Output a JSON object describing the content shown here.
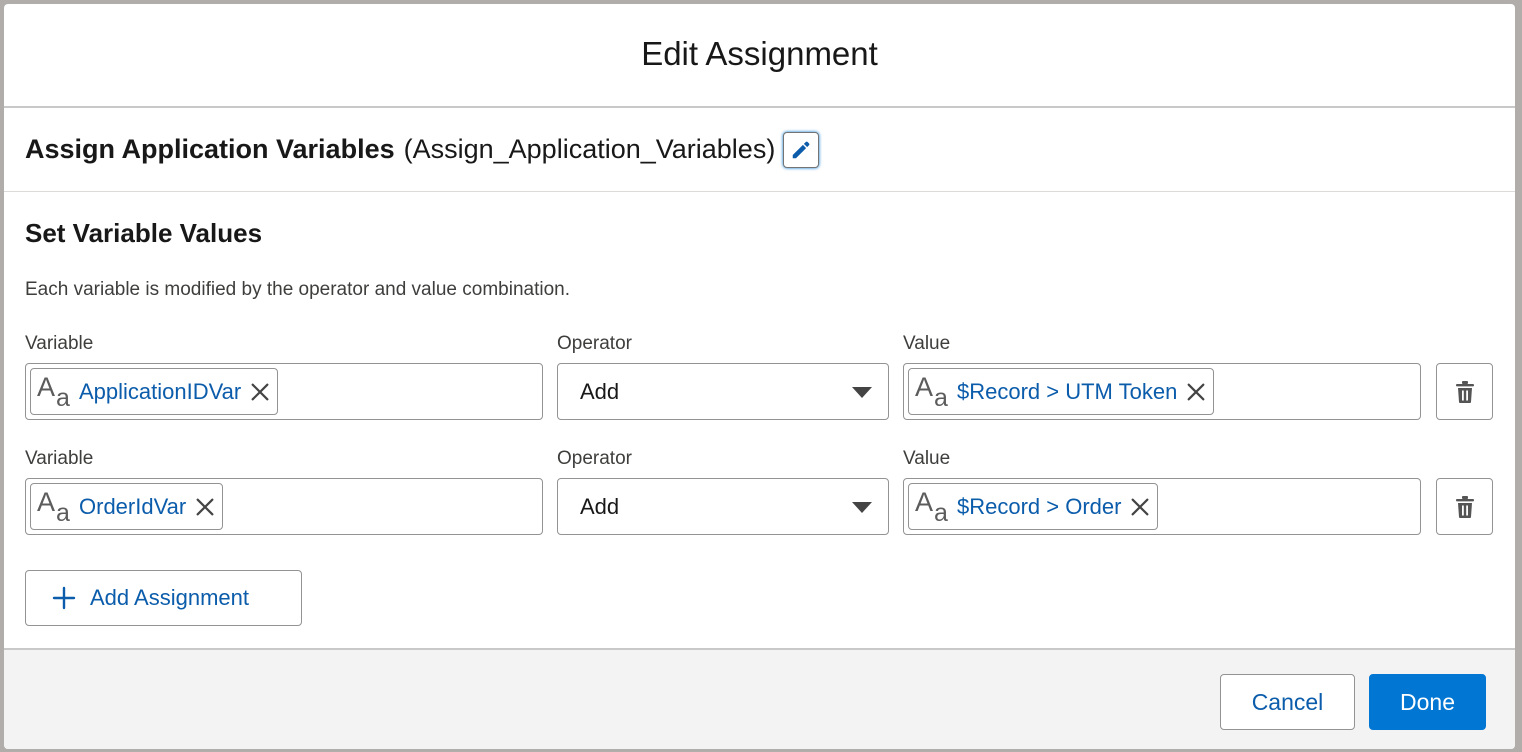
{
  "modal": {
    "title": "Edit Assignment"
  },
  "element": {
    "label": "Assign Application Variables",
    "api_name": "(Assign_Application_Variables)"
  },
  "section": {
    "title": "Set Variable Values",
    "description": "Each variable is modified by the operator and value combination."
  },
  "labels": {
    "variable": "Variable",
    "operator": "Operator",
    "value": "Value"
  },
  "assignments": [
    {
      "variable": "ApplicationIDVar",
      "operator": "Add",
      "value": "$Record > UTM Token"
    },
    {
      "variable": "OrderIdVar",
      "operator": "Add",
      "value": "$Record > Order"
    }
  ],
  "buttons": {
    "add_assignment": "Add Assignment",
    "cancel": "Cancel",
    "done": "Done"
  },
  "icons": {
    "edit": "pencil-icon",
    "text_type": "text-type-icon",
    "remove": "close-icon",
    "delete": "trash-icon",
    "add": "plus-icon"
  },
  "colors": {
    "brand": "#0176d3",
    "link": "#0b5cab"
  }
}
